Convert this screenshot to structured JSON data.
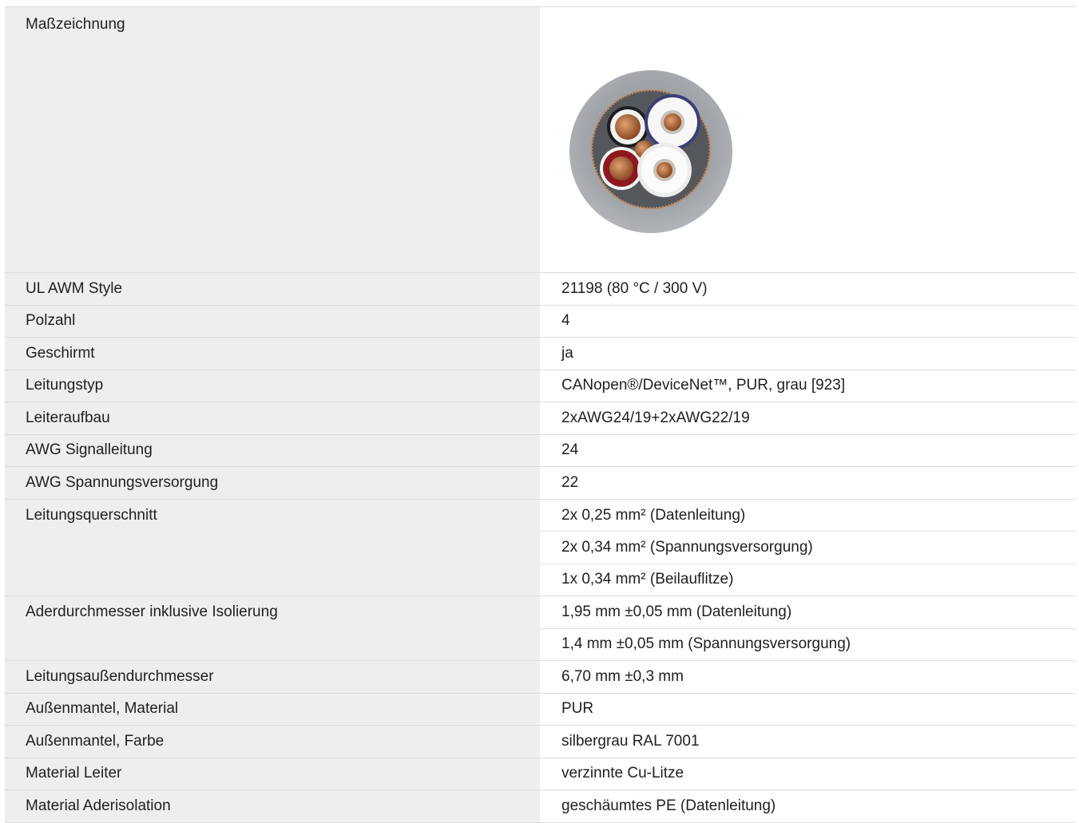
{
  "drawing": {
    "label": "Maßzeichnung",
    "image_alt": "cable cross-section"
  },
  "specs": [
    {
      "label": "UL AWM Style",
      "values": [
        "21198 (80 °C / 300 V)"
      ]
    },
    {
      "label": "Polzahl",
      "values": [
        "4"
      ]
    },
    {
      "label": "Geschirmt",
      "values": [
        "ja"
      ]
    },
    {
      "label": "Leitungstyp",
      "values": [
        "CANopen®/DeviceNet™, PUR, grau [923]"
      ]
    },
    {
      "label": "Leiteraufbau",
      "values": [
        "2xAWG24/19+2xAWG22/19"
      ]
    },
    {
      "label": "AWG Signalleitung",
      "values": [
        "24"
      ]
    },
    {
      "label": "AWG Spannungsversorgung",
      "values": [
        "22"
      ]
    },
    {
      "label": "Leitungsquerschnitt",
      "values": [
        "2x 0,25 mm² (Datenleitung)",
        "2x 0,34 mm² (Spannungsversorgung)",
        "1x 0,34 mm² (Beilauflitze)"
      ]
    },
    {
      "label": "Aderdurchmesser inklusive Isolierung",
      "values": [
        "1,95 mm ±0,05 mm (Datenleitung)",
        "1,4 mm ±0,05 mm (Spannungsversorgung)"
      ]
    },
    {
      "label": "Leitungsaußendurchmesser",
      "values": [
        "6,70 mm ±0,3 mm"
      ]
    },
    {
      "label": "Außenmantel, Material",
      "values": [
        "PUR"
      ]
    },
    {
      "label": "Außenmantel, Farbe",
      "values": [
        "silbergrau RAL 7001"
      ]
    },
    {
      "label": "Material Leiter",
      "values": [
        "verzinnte Cu-Litze"
      ]
    },
    {
      "label": "Material Aderisolation",
      "values": [
        "geschäumtes PE (Datenleitung)"
      ]
    }
  ],
  "colors": {
    "label_bg": "#eeeeee",
    "divider": "#dcdcdc",
    "jacket": "#9a9ea4"
  }
}
